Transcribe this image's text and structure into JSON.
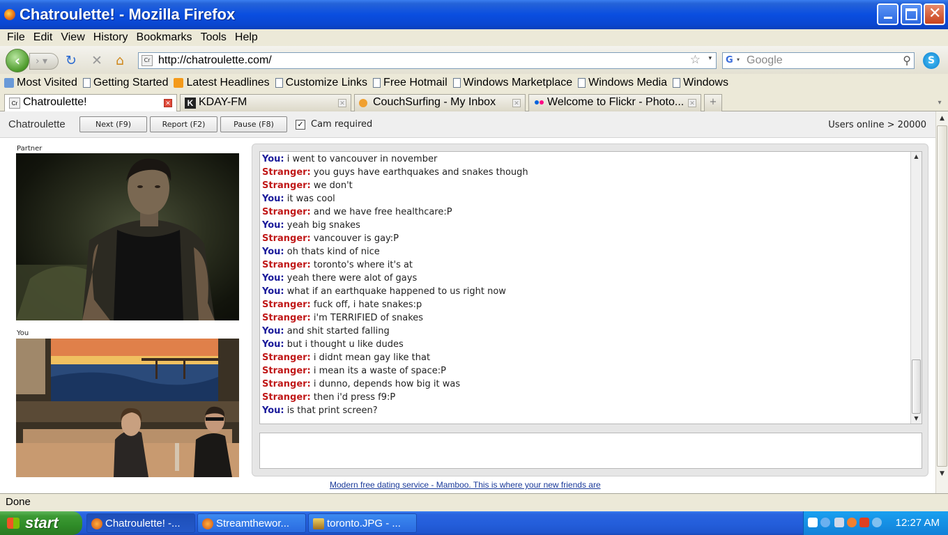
{
  "window": {
    "title": "Chatroulette! - Mozilla Firefox"
  },
  "menu": [
    "File",
    "Edit",
    "View",
    "History",
    "Bookmarks",
    "Tools",
    "Help"
  ],
  "nav": {
    "url": "http://chatroulette.com/",
    "search_placeholder": "Google"
  },
  "bookmarks": [
    {
      "label": "Most Visited",
      "icon": "most-visited-icon"
    },
    {
      "label": "Getting Started",
      "icon": "page-icon"
    },
    {
      "label": "Latest Headlines",
      "icon": "rss-icon"
    },
    {
      "label": "Customize Links",
      "icon": "page-icon"
    },
    {
      "label": "Free Hotmail",
      "icon": "page-icon"
    },
    {
      "label": "Windows Marketplace",
      "icon": "page-icon"
    },
    {
      "label": "Windows Media",
      "icon": "page-icon"
    },
    {
      "label": "Windows",
      "icon": "page-icon"
    }
  ],
  "tabs": [
    {
      "label": "Chatroulette!",
      "active": true
    },
    {
      "label": "KDAY-FM",
      "active": false
    },
    {
      "label": "CouchSurfing - My Inbox",
      "active": false
    },
    {
      "label": "Welcome to Flickr - Photo...",
      "active": false
    }
  ],
  "chat": {
    "brand": "Chatroulette",
    "buttons": {
      "next": "Next (F9)",
      "report": "Report (F2)",
      "pause": "Pause (F8)"
    },
    "cam_required_label": "Cam required",
    "cam_required_checked": true,
    "users_online": "Users online > 20000",
    "partner_label": "Partner",
    "you_label": "You",
    "messages": [
      {
        "who": "You:",
        "text": "i went to vancouver in november"
      },
      {
        "who": "Stranger:",
        "text": "you guys have earthquakes and snakes though"
      },
      {
        "who": "Stranger:",
        "text": "we don't"
      },
      {
        "who": "You:",
        "text": "it was cool"
      },
      {
        "who": "Stranger:",
        "text": "and we have free healthcare:P"
      },
      {
        "who": "You:",
        "text": "yeah big snakes"
      },
      {
        "who": "Stranger:",
        "text": "vancouver is gay:P"
      },
      {
        "who": "You:",
        "text": "oh thats kind of nice"
      },
      {
        "who": "Stranger:",
        "text": "toronto's where it's at"
      },
      {
        "who": "You:",
        "text": "yeah there were alot of gays"
      },
      {
        "who": "You:",
        "text": "what if an earthquake happened to us right now"
      },
      {
        "who": "Stranger:",
        "text": "fuck off, i hate snakes:p"
      },
      {
        "who": "Stranger:",
        "text": "i'm TERRIFIED of snakes"
      },
      {
        "who": "You:",
        "text": "and shit started falling"
      },
      {
        "who": "You:",
        "text": "but i thought u like dudes"
      },
      {
        "who": "Stranger:",
        "text": "i didnt mean gay like that"
      },
      {
        "who": "Stranger:",
        "text": "i mean its a waste of space:P"
      },
      {
        "who": "Stranger:",
        "text": "i dunno, depends how big it was"
      },
      {
        "who": "Stranger:",
        "text": "then i'd press f9:P"
      },
      {
        "who": "You:",
        "text": "is that print screen?"
      }
    ],
    "ad_link": "Modern free dating service - Mamboo. This is where your new friends are"
  },
  "status": "Done",
  "taskbar": {
    "start": "start",
    "items": [
      "Chatroulette! -...",
      "Streamthewor...",
      "toronto.JPG - ..."
    ],
    "clock": "12:27 AM"
  },
  "colors": {
    "you": "#1a1a9a",
    "stranger": "#c01818",
    "title_bar": "#0a4ee0",
    "start_button": "#3d9a34"
  }
}
